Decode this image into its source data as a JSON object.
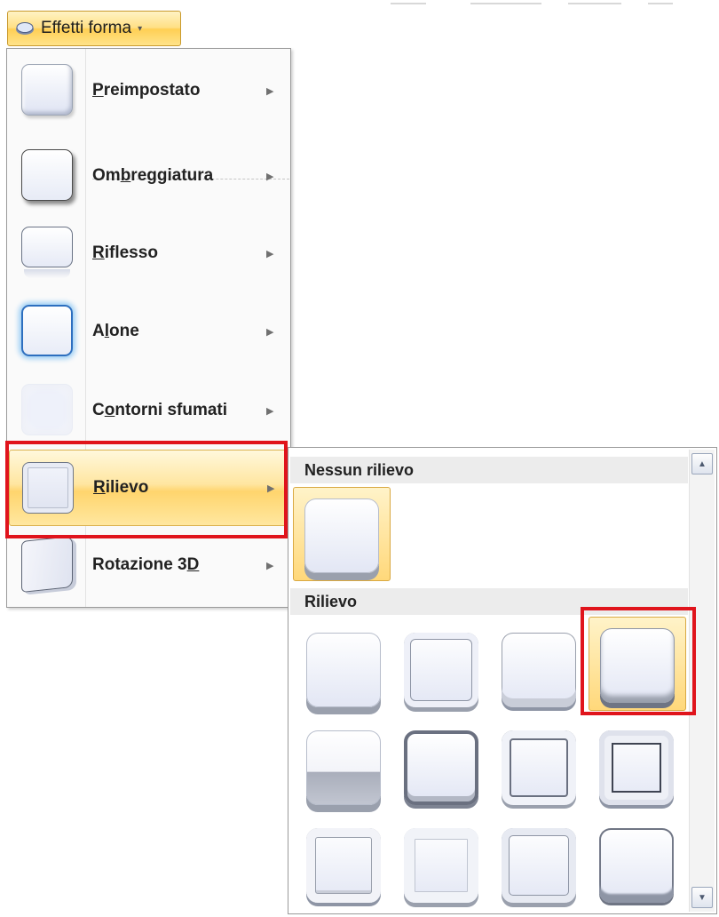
{
  "ribbon": {
    "button_label": "Effetti forma",
    "icon": "shape-effects-icon",
    "caret": "▾"
  },
  "menu": {
    "arrow_glyph": "▶",
    "items": [
      {
        "pre": "",
        "acc": "P",
        "post": "reimpostato",
        "thumb": "preset"
      },
      {
        "pre": "Om",
        "acc": "b",
        "post": "reggiatura",
        "thumb": "shadow"
      },
      {
        "pre": "",
        "acc": "R",
        "post": "iflesso",
        "thumb": "reflection"
      },
      {
        "pre": "A",
        "acc": "l",
        "post": "one",
        "thumb": "glow"
      },
      {
        "pre": "C",
        "acc": "o",
        "post": "ntorni sfumati",
        "thumb": "soft-edges"
      },
      {
        "pre": "",
        "acc": "R",
        "post": "ilievo",
        "thumb": "bevel",
        "active": true
      },
      {
        "pre": "Rotazione 3",
        "acc": "D",
        "post": "",
        "thumb": "3d-rotation"
      }
    ]
  },
  "gallery": {
    "section_none": "Nessun rilievo",
    "section_bevel": "Rilievo",
    "bevel_count": 12,
    "selected_bevel_index": 4,
    "scroll_up": "▲",
    "scroll_down": "▼"
  },
  "colors": {
    "highlight_red": "#e0141c",
    "hover_gold": "#ffd56d"
  }
}
